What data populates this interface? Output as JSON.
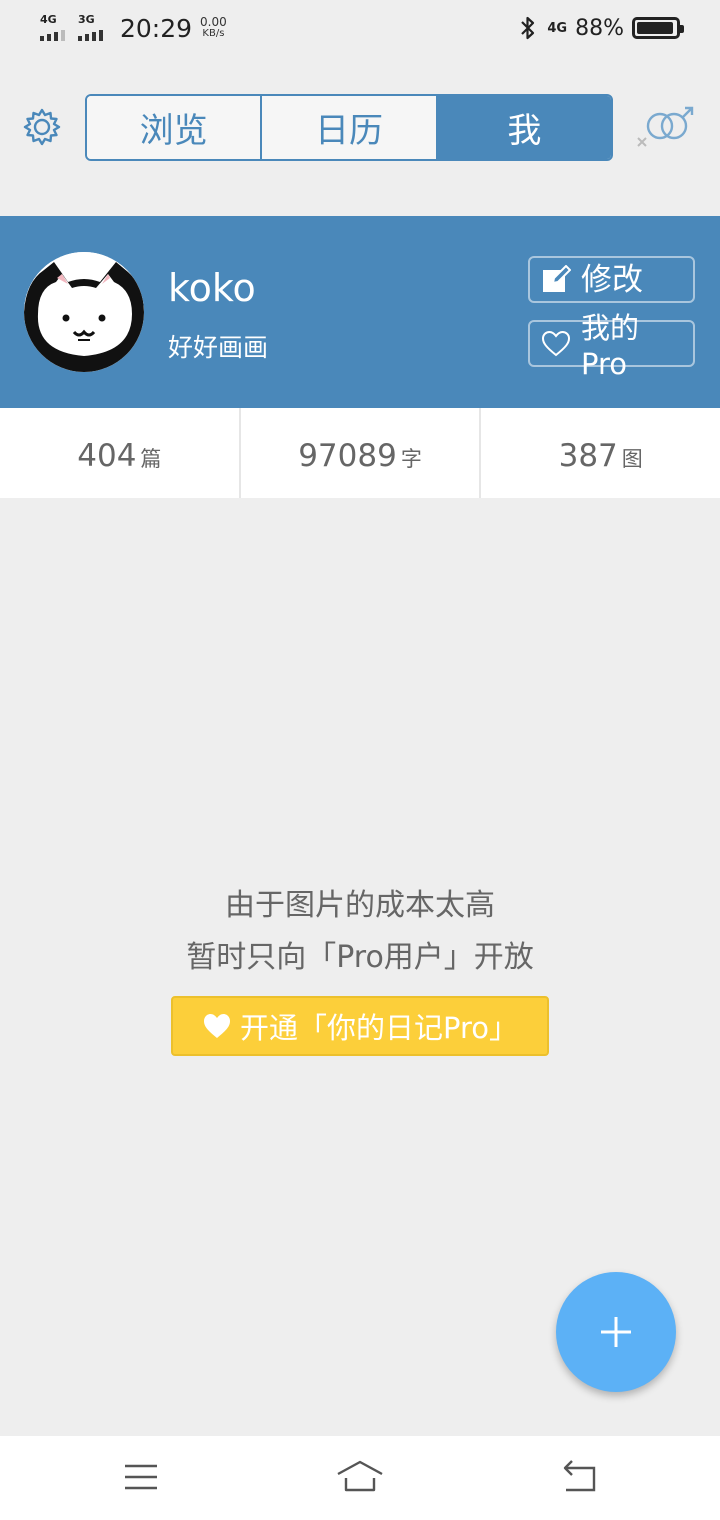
{
  "status_bar": {
    "network1": "4G",
    "network2": "3G",
    "time": "20:29",
    "speed_value": "0.00",
    "speed_unit": "KB/s",
    "network_right": "4G",
    "battery_percent": "88%"
  },
  "tabs": [
    {
      "label": "浏览",
      "active": false
    },
    {
      "label": "日历",
      "active": false
    },
    {
      "label": "我",
      "active": true
    }
  ],
  "profile": {
    "username": "koko",
    "bio": "好好画画",
    "edit_label": "修改",
    "pro_label": "我的Pro",
    "background": "#4a88ba"
  },
  "stats": [
    {
      "value": "404",
      "unit": "篇"
    },
    {
      "value": "97089",
      "unit": "字"
    },
    {
      "value": "387",
      "unit": "图"
    }
  ],
  "empty_state": {
    "line1": "由于图片的成本太高",
    "line2": "暂时只向「Pro用户」开放",
    "cta_label": "开通「你的日记Pro」",
    "cta_color": "#fccf3a"
  },
  "icons": {
    "settings": "gear-icon",
    "gender": "gender-icon",
    "edit": "edit-icon",
    "heart": "heart-icon",
    "fab": "plus-icon",
    "nav": [
      "menu-icon",
      "home-icon",
      "back-icon"
    ]
  },
  "colors": {
    "accent": "#4a88ba",
    "fab": "#5cb1f6",
    "background": "#eeeeee"
  }
}
